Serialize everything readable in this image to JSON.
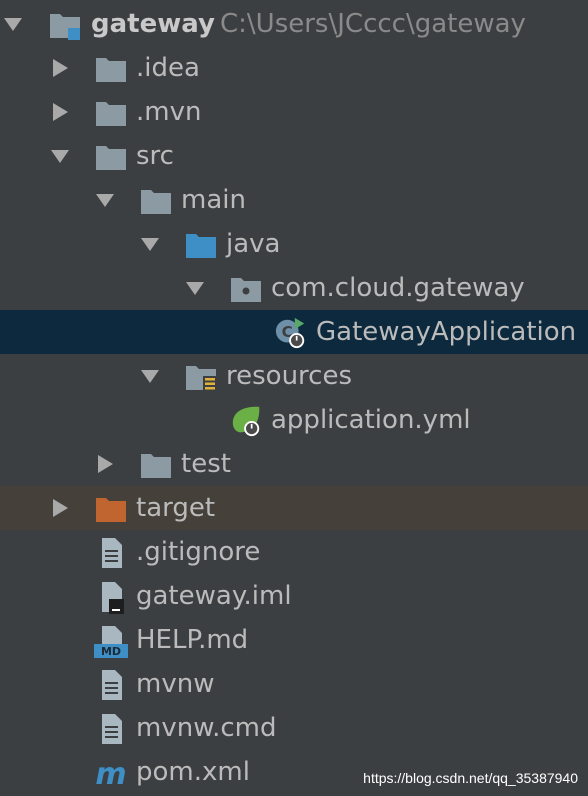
{
  "project": {
    "name": "gateway",
    "path": "C:\\Users\\JCccc\\gateway"
  },
  "items": [
    {
      "label": "gateway",
      "depth": 0
    },
    {
      "label": ".idea"
    },
    {
      "label": ".mvn"
    },
    {
      "label": "src"
    },
    {
      "label": "main"
    },
    {
      "label": "java"
    },
    {
      "label": "com.cloud.gateway"
    },
    {
      "label": "GatewayApplication"
    },
    {
      "label": "resources"
    },
    {
      "label": "application.yml"
    },
    {
      "label": "test"
    },
    {
      "label": "target"
    },
    {
      "label": ".gitignore"
    },
    {
      "label": "gateway.iml"
    },
    {
      "label": "HELP.md"
    },
    {
      "label": "mvnw"
    },
    {
      "label": "mvnw.cmd"
    },
    {
      "label": "pom.xml"
    }
  ],
  "watermark": "https://blog.csdn.net/qq_35387940",
  "colors": {
    "background": "#3c3f41",
    "selected_row": "#0d293e",
    "excluded_row": "#45403a",
    "folder": "#8c9aa3",
    "source_folder": "#3d8fc6",
    "excluded_folder": "#c06530",
    "spring_green": "#6bb046"
  }
}
